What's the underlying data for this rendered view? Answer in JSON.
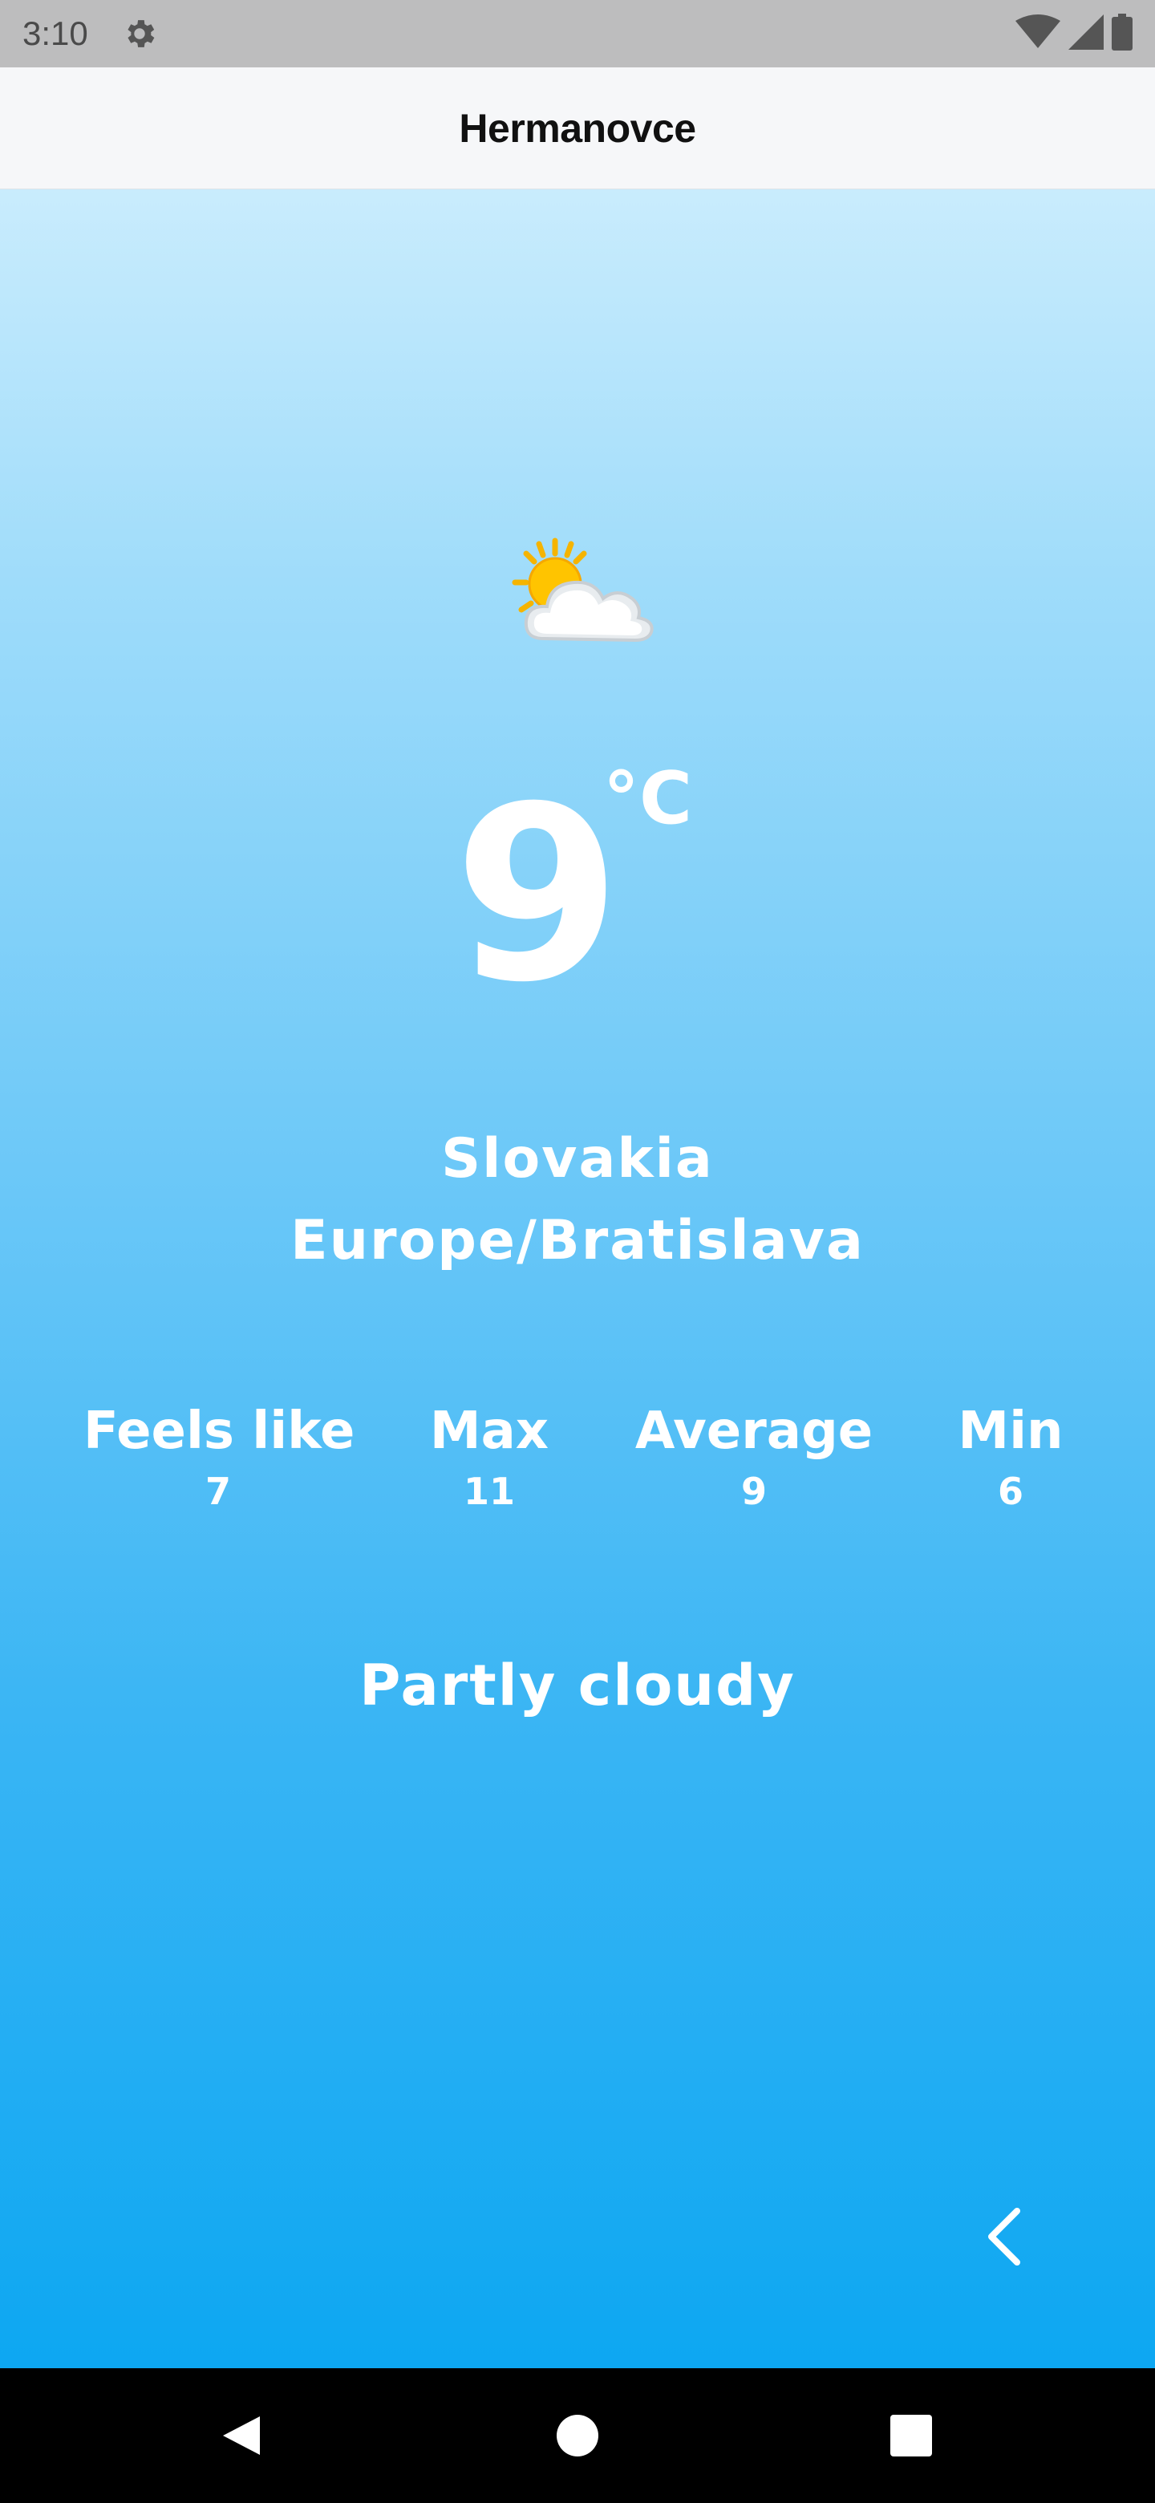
{
  "status_bar": {
    "time": "3:10",
    "icons": [
      "gear-icon",
      "wifi-icon",
      "signal-icon",
      "battery-icon"
    ]
  },
  "app_bar": {
    "title": "Hermanovce"
  },
  "weather": {
    "icon": "partly-cloudy-icon",
    "temperature": "9",
    "unit": "°C",
    "country": "Slovakia",
    "timezone": "Europe/Bratislava",
    "stats": {
      "feels_like": {
        "label": "Feels like",
        "value": "7"
      },
      "max": {
        "label": "Max",
        "value": "11"
      },
      "average": {
        "label": "Average",
        "value": "9"
      },
      "min": {
        "label": "Min",
        "value": "6"
      }
    },
    "condition": "Partly cloudy"
  },
  "navigation": {
    "back_icon": "chevron-left-icon",
    "system_buttons": [
      "back-triangle-icon",
      "home-circle-icon",
      "recents-square-icon"
    ]
  },
  "colors": {
    "gradient_top": "#c9ecfd",
    "gradient_bottom": "#0da7f2",
    "text": "#ffffff",
    "app_bar_bg": "#f6f7f9",
    "status_bar_bg": "#bdbdbe"
  }
}
